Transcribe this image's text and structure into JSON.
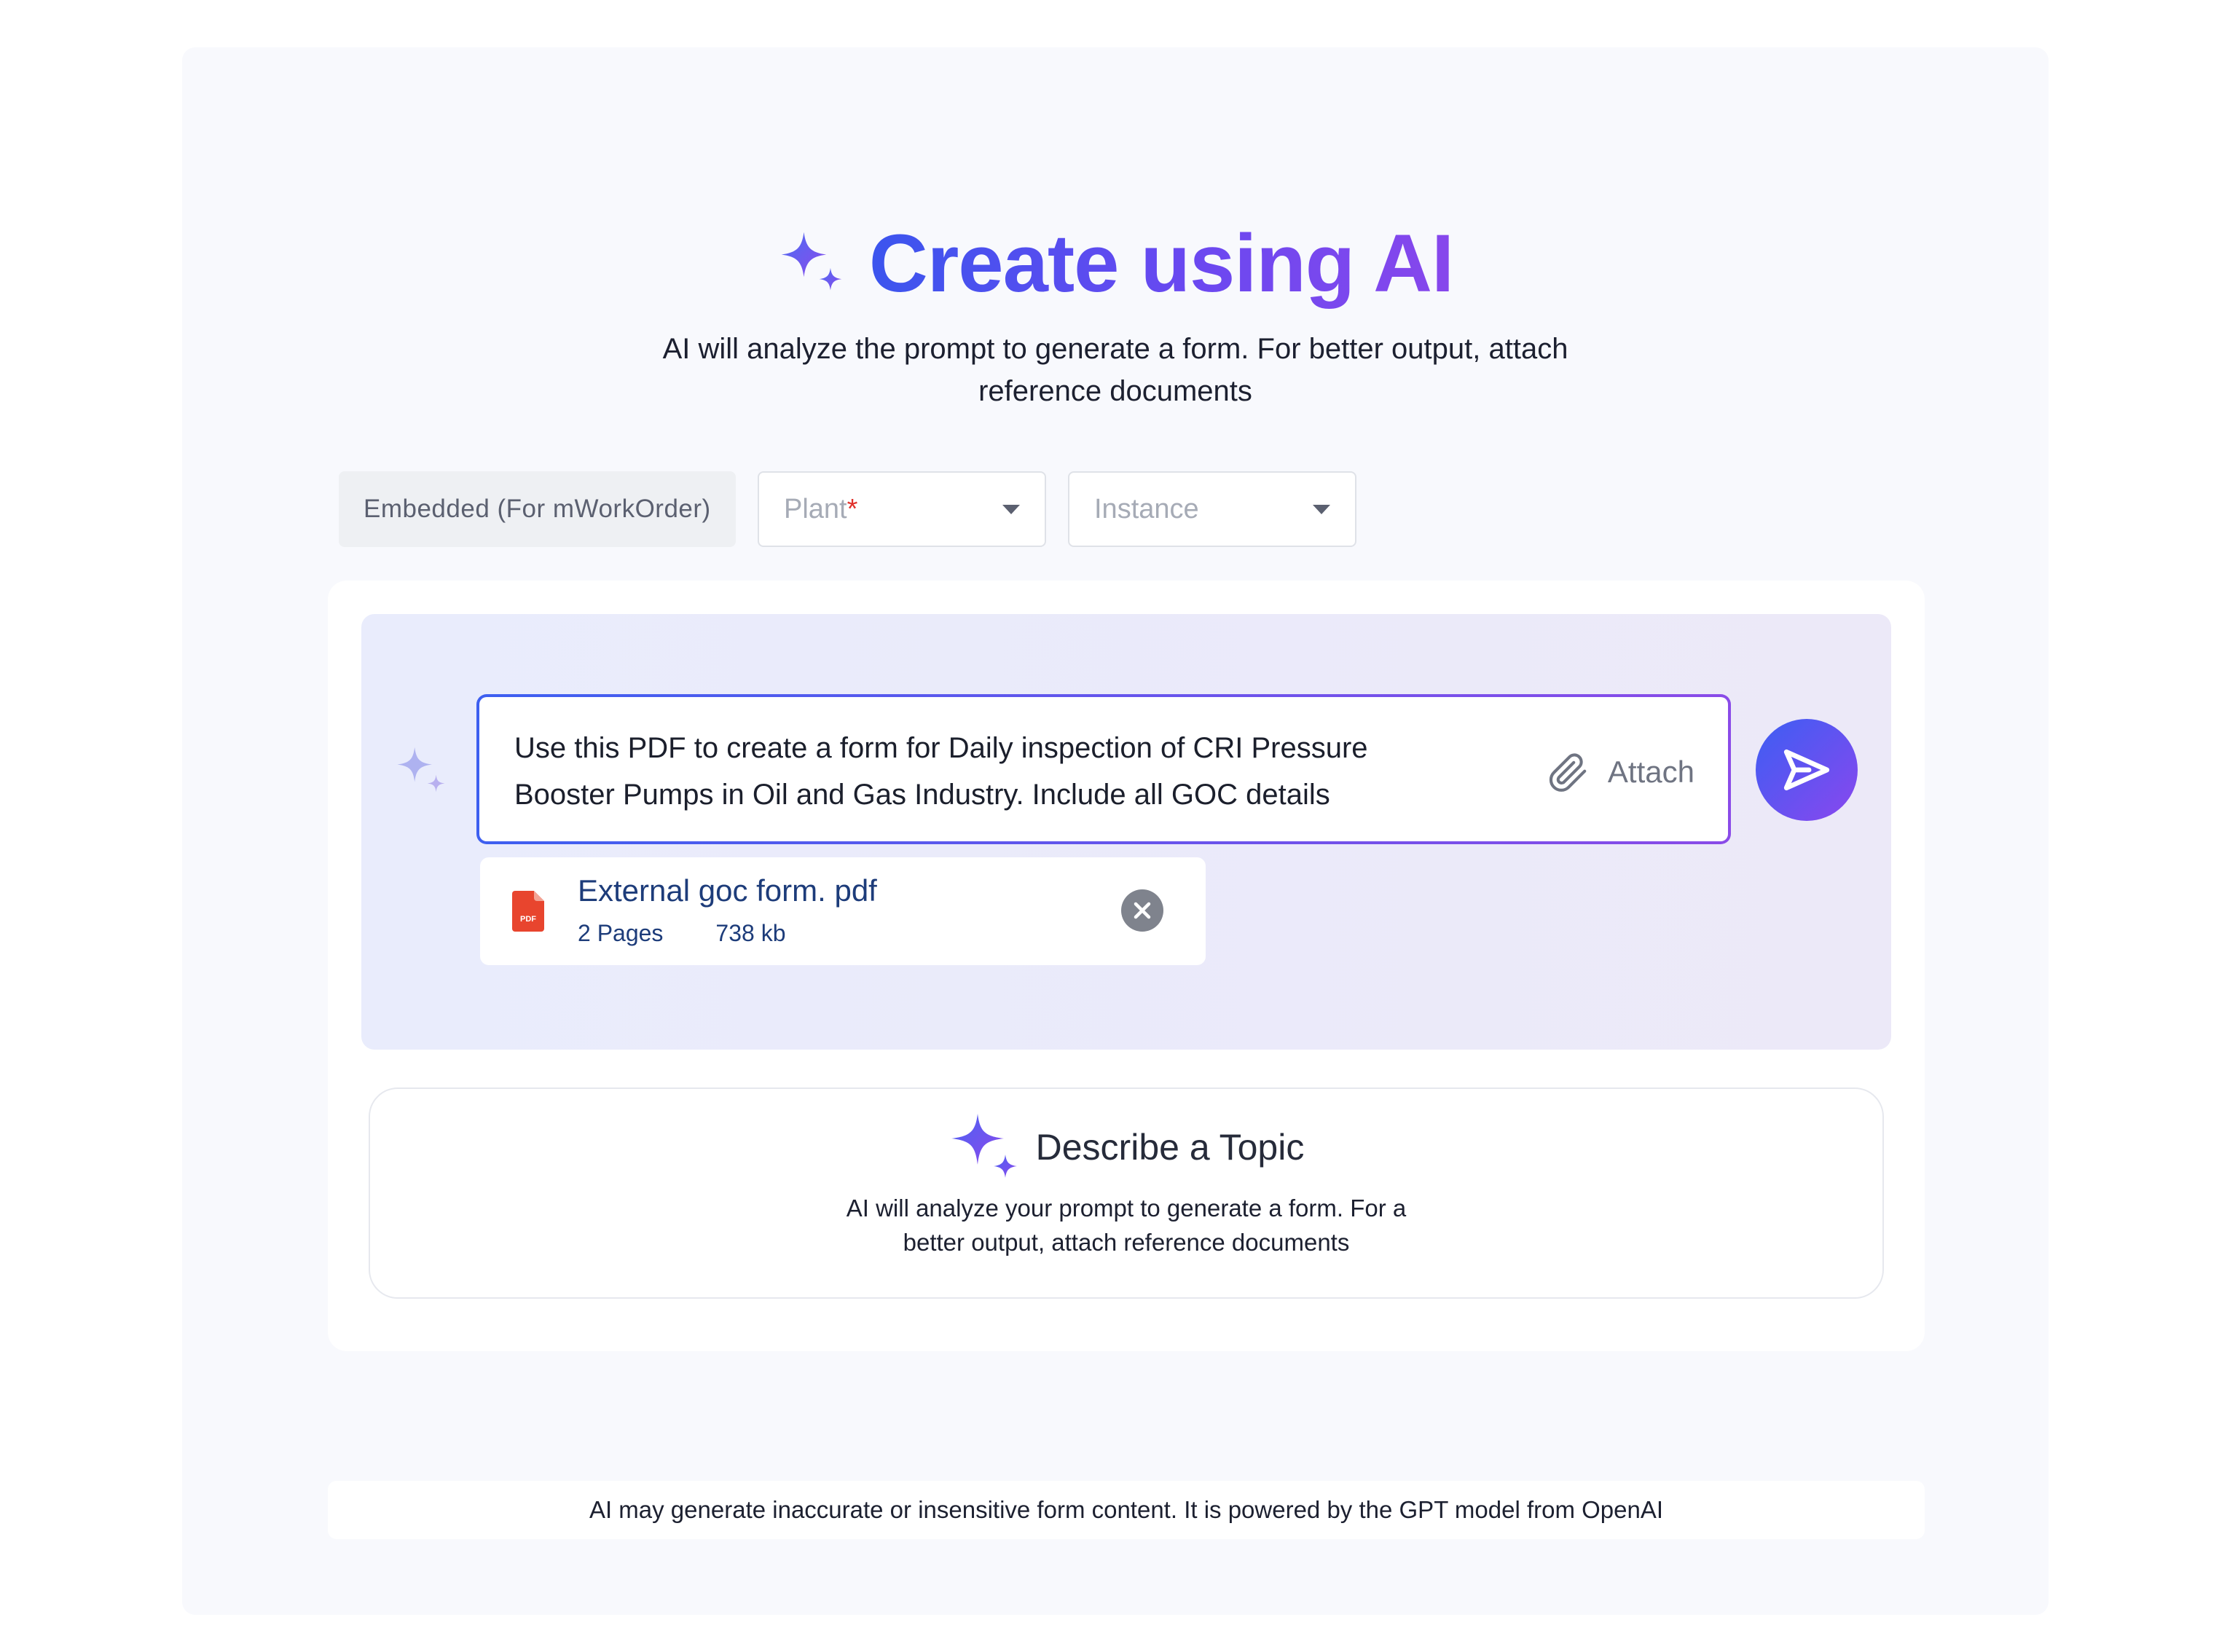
{
  "header": {
    "title": "Create using AI",
    "subtitle_line1": "AI will analyze the prompt to generate a form. For better output, attach",
    "subtitle_line2": "reference documents",
    "icon": "sparkle-icon"
  },
  "selectors": {
    "embedded_label": "Embedded (For mWorkOrder)",
    "plant_placeholder": "Plant",
    "plant_required_mark": "*",
    "instance_placeholder": "Instance"
  },
  "prompt": {
    "text_line1": "Use this PDF to create a form for Daily inspection of CRI Pressure",
    "text_line2": "Booster Pumps in Oil and Gas Industry. Include all GOC details",
    "attach_label": "Attach",
    "send_icon": "send-icon"
  },
  "attachment": {
    "name": "External goc form. pdf",
    "pages": "2 Pages",
    "size": "738 kb",
    "file_icon": "pdf-icon",
    "pdf_badge": "PDF"
  },
  "topic": {
    "title": "Describe a Topic",
    "desc_line1": "AI will analyze your prompt to generate a form. For a",
    "desc_line2": "better output, attach reference documents"
  },
  "footer": {
    "disclaimer": "AI may generate inaccurate or insensitive form content. It is powered by the GPT model from OpenAI"
  },
  "colors": {
    "brand_blue": "#3b55ee",
    "brand_purple": "#8747ec",
    "required_red": "#e0312b",
    "pdf_red": "#e8452e"
  }
}
